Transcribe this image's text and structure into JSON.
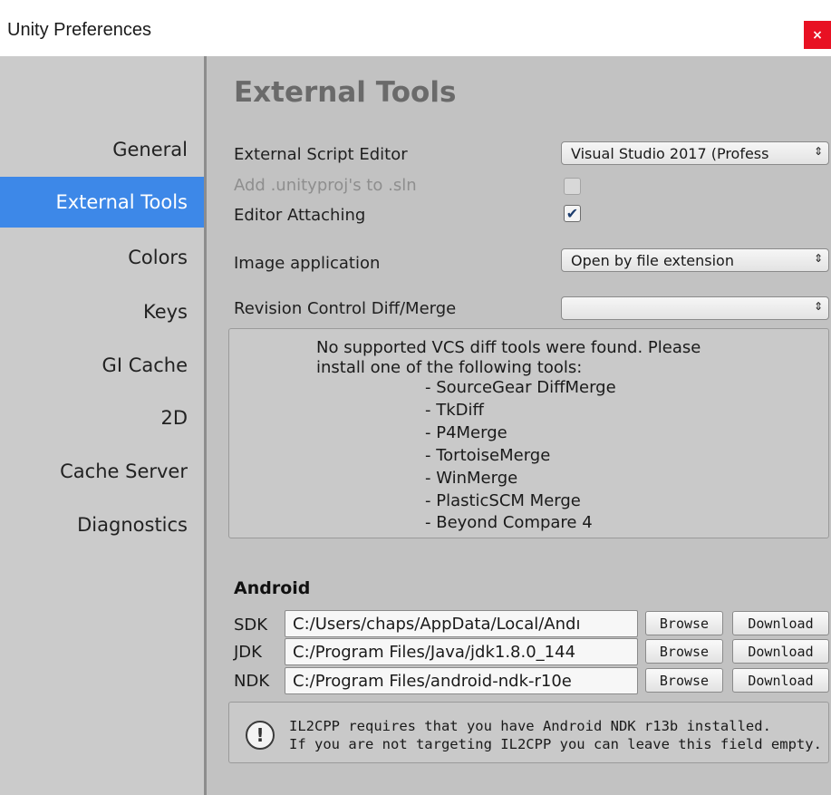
{
  "window": {
    "title": "Unity Preferences",
    "close_icon": "×"
  },
  "sidebar": {
    "items": [
      {
        "label": "General"
      },
      {
        "label": "External Tools"
      },
      {
        "label": "Colors"
      },
      {
        "label": "Keys"
      },
      {
        "label": "GI Cache"
      },
      {
        "label": "2D"
      },
      {
        "label": "Cache Server"
      },
      {
        "label": "Diagnostics"
      }
    ],
    "active": "External Tools"
  },
  "main": {
    "title": "External Tools",
    "script_editor_label": "External Script Editor",
    "script_editor_value": "Visual Studio 2017 (Profess",
    "add_unityproj_label": "Add .unityproj's to .sln",
    "add_unityproj_checked": false,
    "editor_attaching_label": "Editor Attaching",
    "editor_attaching_checked": true,
    "checkmark": "✔",
    "image_app_label": "Image application",
    "image_app_value": "Open by file extension",
    "revision_label": "Revision Control Diff/Merge",
    "revision_value": "",
    "popup_arrows": "⇕",
    "vcs_message_line1": "No supported VCS diff tools were found. Please",
    "vcs_message_line2": "install one of the following tools:",
    "vcs_tools": [
      "- SourceGear DiffMerge",
      "- TkDiff",
      "- P4Merge",
      "- TortoiseMerge",
      "- WinMerge",
      "- PlasticSCM Merge",
      "- Beyond Compare 4"
    ]
  },
  "android": {
    "title": "Android",
    "rows": [
      {
        "label": "SDK",
        "path": "C:/Users/chaps/AppData/Local/Andı",
        "browse": "Browse",
        "download": "Download"
      },
      {
        "label": "JDK",
        "path": "C:/Program Files/Java/jdk1.8.0_144",
        "browse": "Browse",
        "download": "Download"
      },
      {
        "label": "NDK",
        "path": "C:/Program Files/android-ndk-r10e",
        "browse": "Browse",
        "download": "Download"
      }
    ],
    "warning_icon": "!",
    "warning_line1": "IL2CPP requires that you have Android NDK r13b installed.",
    "warning_line2": "If you are not targeting IL2CPP you can leave this field empty."
  }
}
